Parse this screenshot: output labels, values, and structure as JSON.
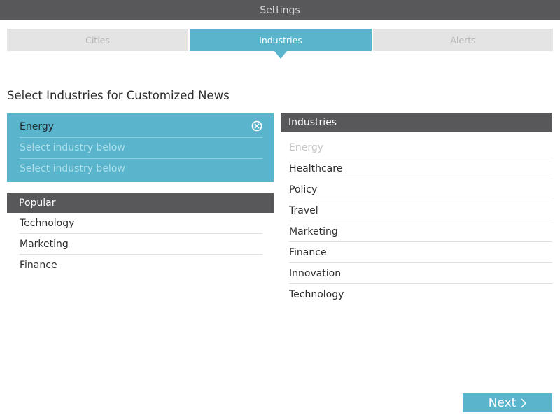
{
  "window": {
    "title": "Settings"
  },
  "tabs": [
    {
      "label": "Cities",
      "active": false
    },
    {
      "label": "Industries",
      "active": true
    },
    {
      "label": "Alerts",
      "active": false
    }
  ],
  "section_title": "Select Industries for Customized News",
  "selected": {
    "items": [
      {
        "label": "Energy",
        "removable": true,
        "icon": "remove-circle-icon"
      },
      {
        "label": "Select industry below",
        "placeholder": true
      },
      {
        "label": "Select industry below",
        "placeholder": true
      }
    ]
  },
  "popular": {
    "header": "Popular",
    "items": [
      "Technology",
      "Marketing",
      "Finance"
    ]
  },
  "industries": {
    "header": "Industries",
    "items": [
      {
        "label": "Energy",
        "disabled": true
      },
      {
        "label": "Healthcare",
        "disabled": false
      },
      {
        "label": "Policy",
        "disabled": false
      },
      {
        "label": "Travel",
        "disabled": false
      },
      {
        "label": "Marketing",
        "disabled": false
      },
      {
        "label": "Finance",
        "disabled": false
      },
      {
        "label": "Innovation",
        "disabled": false
      },
      {
        "label": "Technology",
        "disabled": false
      }
    ]
  },
  "footer": {
    "next_label": "Next",
    "next_icon": "chevron-right-icon"
  },
  "colors": {
    "accent": "#5ab4cc",
    "header_dark": "#58585a",
    "tab_inactive": "#e4e4e4",
    "disabled_text": "#c4c4c4"
  }
}
